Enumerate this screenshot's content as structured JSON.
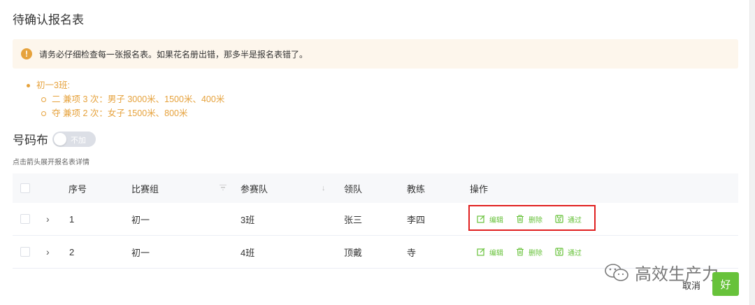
{
  "dialog": {
    "title": "待确认报名表"
  },
  "alert": {
    "icon": "warning-icon",
    "text": "请务必仔细检查每一张报名表。如果花名册出错，那多半是报名表错了。"
  },
  "notes": {
    "group": "初一3班:",
    "items": [
      "二 兼项 3 次：男子 3000米、1500米、400米",
      "夺 兼项 2 次：女子 1500米、800米"
    ]
  },
  "bib_switch": {
    "label": "号码布",
    "state_text": "不加"
  },
  "hint": "点击箭头展开报名表详情",
  "table": {
    "headers": {
      "index": "序号",
      "group": "比赛组",
      "team": "参赛队",
      "leader": "领队",
      "coach": "教练",
      "actions": "操作"
    },
    "rows": [
      {
        "index": "1",
        "group": "初一",
        "team": "3班",
        "leader": "张三",
        "coach": "李四"
      },
      {
        "index": "2",
        "group": "初一",
        "team": "4班",
        "leader": "顶戴",
        "coach": "寺"
      }
    ],
    "actions": {
      "edit": "编辑",
      "delete": "删除",
      "approve": "通过"
    }
  },
  "watermark": "高效生产力",
  "footer": {
    "cancel": "取消",
    "ok": "好"
  },
  "colors": {
    "accent": "#67c23a",
    "warning": "#e6a23c",
    "highlight_box": "#e02020"
  }
}
